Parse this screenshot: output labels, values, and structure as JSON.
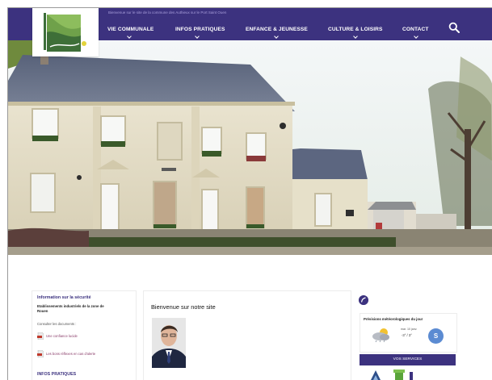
{
  "header": {
    "tagline": "Bienvenue sur le site de la commune des Authieux sur le Port Saint Ouen",
    "nav": [
      {
        "label": "VIE COMMUNALE"
      },
      {
        "label": "INFOS PRATIQUES"
      },
      {
        "label": "ENFANCE & JEUNESSE"
      },
      {
        "label": "CULTURE & LOISIRS"
      },
      {
        "label": "CONTACT"
      }
    ],
    "logo_text": "Authieux sur le port"
  },
  "security": {
    "title": "Information sur la sécurité",
    "subtitle_line1": "Etablissements industriels de la zone de",
    "subtitle_line2": "Rouen",
    "consult": "Consulter les documents :",
    "links": [
      "Une confiance lucide",
      "Les bons réflexes en cas d'alerte"
    ]
  },
  "infos_pratiques_title": "INFOS PRATIQUES",
  "welcome": {
    "title": "Bienvenue sur notre site"
  },
  "weather": {
    "title": "Prévisions météorologiques du jour",
    "day": "mar. 10 janv.",
    "temps": "-3° / 3°",
    "badge": "S"
  },
  "services": {
    "label": "VOS SERVICES"
  },
  "colors": {
    "brand": "#3c327f",
    "link": "#8a3d6a",
    "weather_badge": "#5b8bd2"
  },
  "icons": [
    "search-icon",
    "chevron-down-icon",
    "facebook-icon",
    "pdf-icon",
    "weather-cloud-icon"
  ]
}
